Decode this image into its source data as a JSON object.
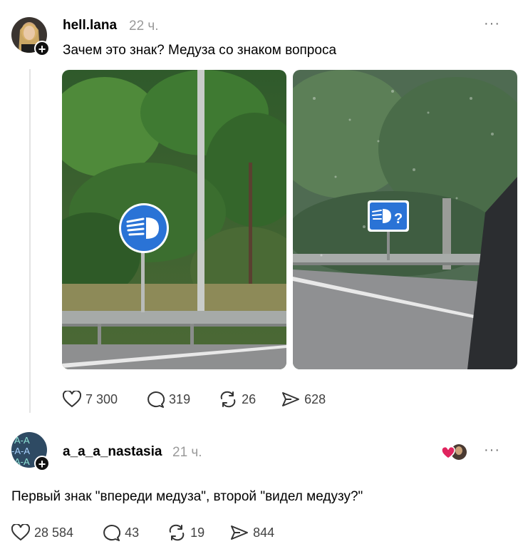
{
  "post": {
    "username": "hell.lana",
    "time": "22 ч.",
    "text": "Зачем это знак? Медуза со знаком вопроса",
    "more_label": "···",
    "images": [
      {
        "icon": "headlight-sign-image",
        "description_icon": "blue-round-sign"
      },
      {
        "icon": "headlight-question-sign-image",
        "description_icon": "blue-square-sign"
      }
    ],
    "stats": {
      "likes": "7 300",
      "comments": "319",
      "reposts": "26",
      "shares": "628"
    }
  },
  "reply": {
    "username": "a_a_a_nastasia",
    "time": "21 ч.",
    "text": "Первый знак \"впереди медуза\", второй \"видел медузу?\"",
    "more_label": "···",
    "stats": {
      "likes": "28 584",
      "comments": "43",
      "reposts": "19",
      "shares": "844"
    }
  },
  "colors": {
    "sign_blue": "#2a73d6",
    "text_muted": "#9a9a9a",
    "like_heart": "#e0245e"
  }
}
